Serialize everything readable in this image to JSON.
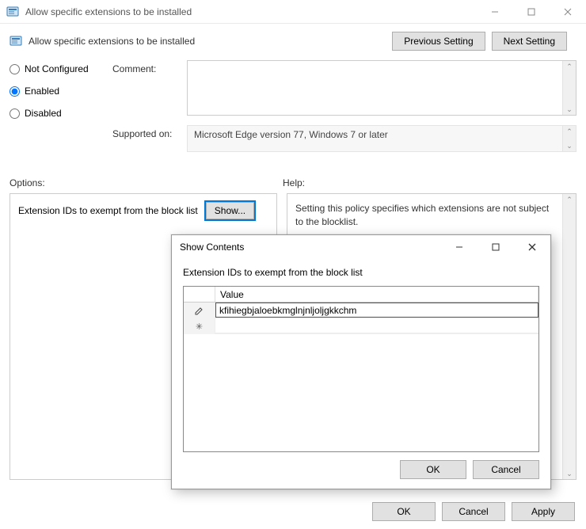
{
  "window": {
    "title": "Allow specific extensions to be installed"
  },
  "policy": {
    "title": "Allow specific extensions to be installed",
    "nav": {
      "prev": "Previous Setting",
      "next": "Next Setting"
    },
    "radios": {
      "not_configured": "Not Configured",
      "enabled": "Enabled",
      "disabled": "Disabled",
      "selected": "enabled"
    },
    "comment_label": "Comment:",
    "comment_value": "",
    "supported_label": "Supported on:",
    "supported_value": "Microsoft Edge version 77, Windows 7 or later"
  },
  "lower": {
    "options_heading": "Options:",
    "help_heading": "Help:",
    "options_text": "Extension IDs to exempt from the block list",
    "show_label": "Show...",
    "help_text": "Setting this policy specifies which extensions are not subject to the blocklist."
  },
  "footer": {
    "ok": "OK",
    "cancel": "Cancel",
    "apply": "Apply"
  },
  "modal": {
    "title": "Show Contents",
    "label": "Extension IDs to exempt from the block list",
    "header_value": "Value",
    "rows": [
      {
        "icon": "edit",
        "value": "kfihiegbjaloebkmglnjnljoljgkkchm"
      },
      {
        "icon": "new",
        "value": ""
      }
    ],
    "ok": "OK",
    "cancel": "Cancel"
  }
}
